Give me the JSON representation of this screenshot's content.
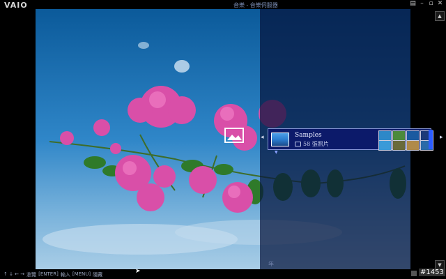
{
  "window": {
    "logo": "VAIO",
    "buttons": [
      {
        "name": "menu-window-icon",
        "glyph": "▤"
      },
      {
        "name": "minimize-icon",
        "glyph": "–"
      },
      {
        "name": "restore-icon",
        "glyph": "▫"
      },
      {
        "name": "close-icon",
        "glyph": "✕"
      }
    ]
  },
  "breadcrumb": "音樂 - 音樂伺服器",
  "album": {
    "title": "Samples",
    "count": "58 張照片"
  },
  "ghost_text": "年",
  "help_bar": {
    "arrows": "↑ ↓ ← →",
    "arrows_label": "瀏覽",
    "enter_key": "[ENTER]",
    "enter_label": "輸入",
    "menu_key": "[MENU]",
    "menu_label": "隱藏"
  },
  "badge": "#1453",
  "colors": {
    "accent": "#2b5cff",
    "strip_bg": "#0c1a6a",
    "overlay": "#05143c"
  }
}
